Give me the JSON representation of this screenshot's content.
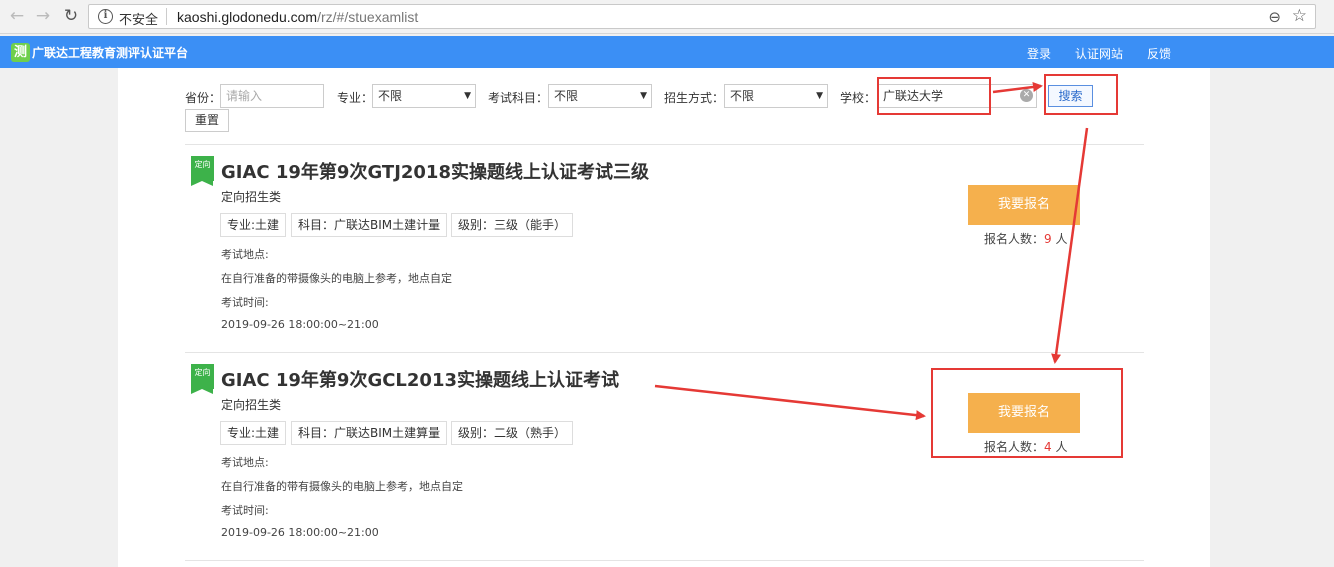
{
  "browser": {
    "security_label": "不安全",
    "url_host": "kaoshi.glodonedu.com",
    "url_path": "/rz/#/stuexamlist"
  },
  "header": {
    "logo_glyph": "测",
    "title": "广联达工程教育测评认证平台",
    "nav": [
      "登录",
      "认证网站",
      "反馈"
    ],
    "bg_color": "#3b8ff5"
  },
  "filters": {
    "province_label": "省份：",
    "province_placeholder": "请输入",
    "major_label": "专业：",
    "major_value": "不限",
    "subject_label": "考试科目：",
    "subject_value": "不限",
    "enroll_label": "招生方式：",
    "enroll_value": "不限",
    "school_label": "学校：",
    "school_value": "广联达大学",
    "search_label": "搜索",
    "reset_label": "重置"
  },
  "exams": [
    {
      "badge": "定向",
      "title": "GIAC 19年第9次GTJ2018实操题线上认证考试三级",
      "type": "定向招生类",
      "tags": [
        "专业:土建",
        "科目：广联达BIM土建计量",
        "级别：三级（能手）"
      ],
      "location_label": "考试地点:",
      "location": "在自行准备的带摄像头的电脑上参考，地点自定",
      "time_label": "考试时间:",
      "time": "2019-09-26 18:00:00~21:00",
      "signup_label": "我要报名",
      "count_prefix": "报名人数：",
      "count": "9",
      "count_suffix": " 人"
    },
    {
      "badge": "定向",
      "title": "GIAC 19年第9次GCL2013实操题线上认证考试",
      "type": "定向招生类",
      "tags": [
        "专业:土建",
        "科目：广联达BIM土建算量",
        "级别：二级（熟手）"
      ],
      "location_label": "考试地点:",
      "location": "在自行准备的带有摄像头的电脑上参考，地点自定",
      "time_label": "考试时间:",
      "time": "2019-09-26 18:00:00~21:00",
      "signup_label": "我要报名",
      "count_prefix": "报名人数：",
      "count": "4",
      "count_suffix": " 人"
    }
  ],
  "annotation_color": "#e53935"
}
